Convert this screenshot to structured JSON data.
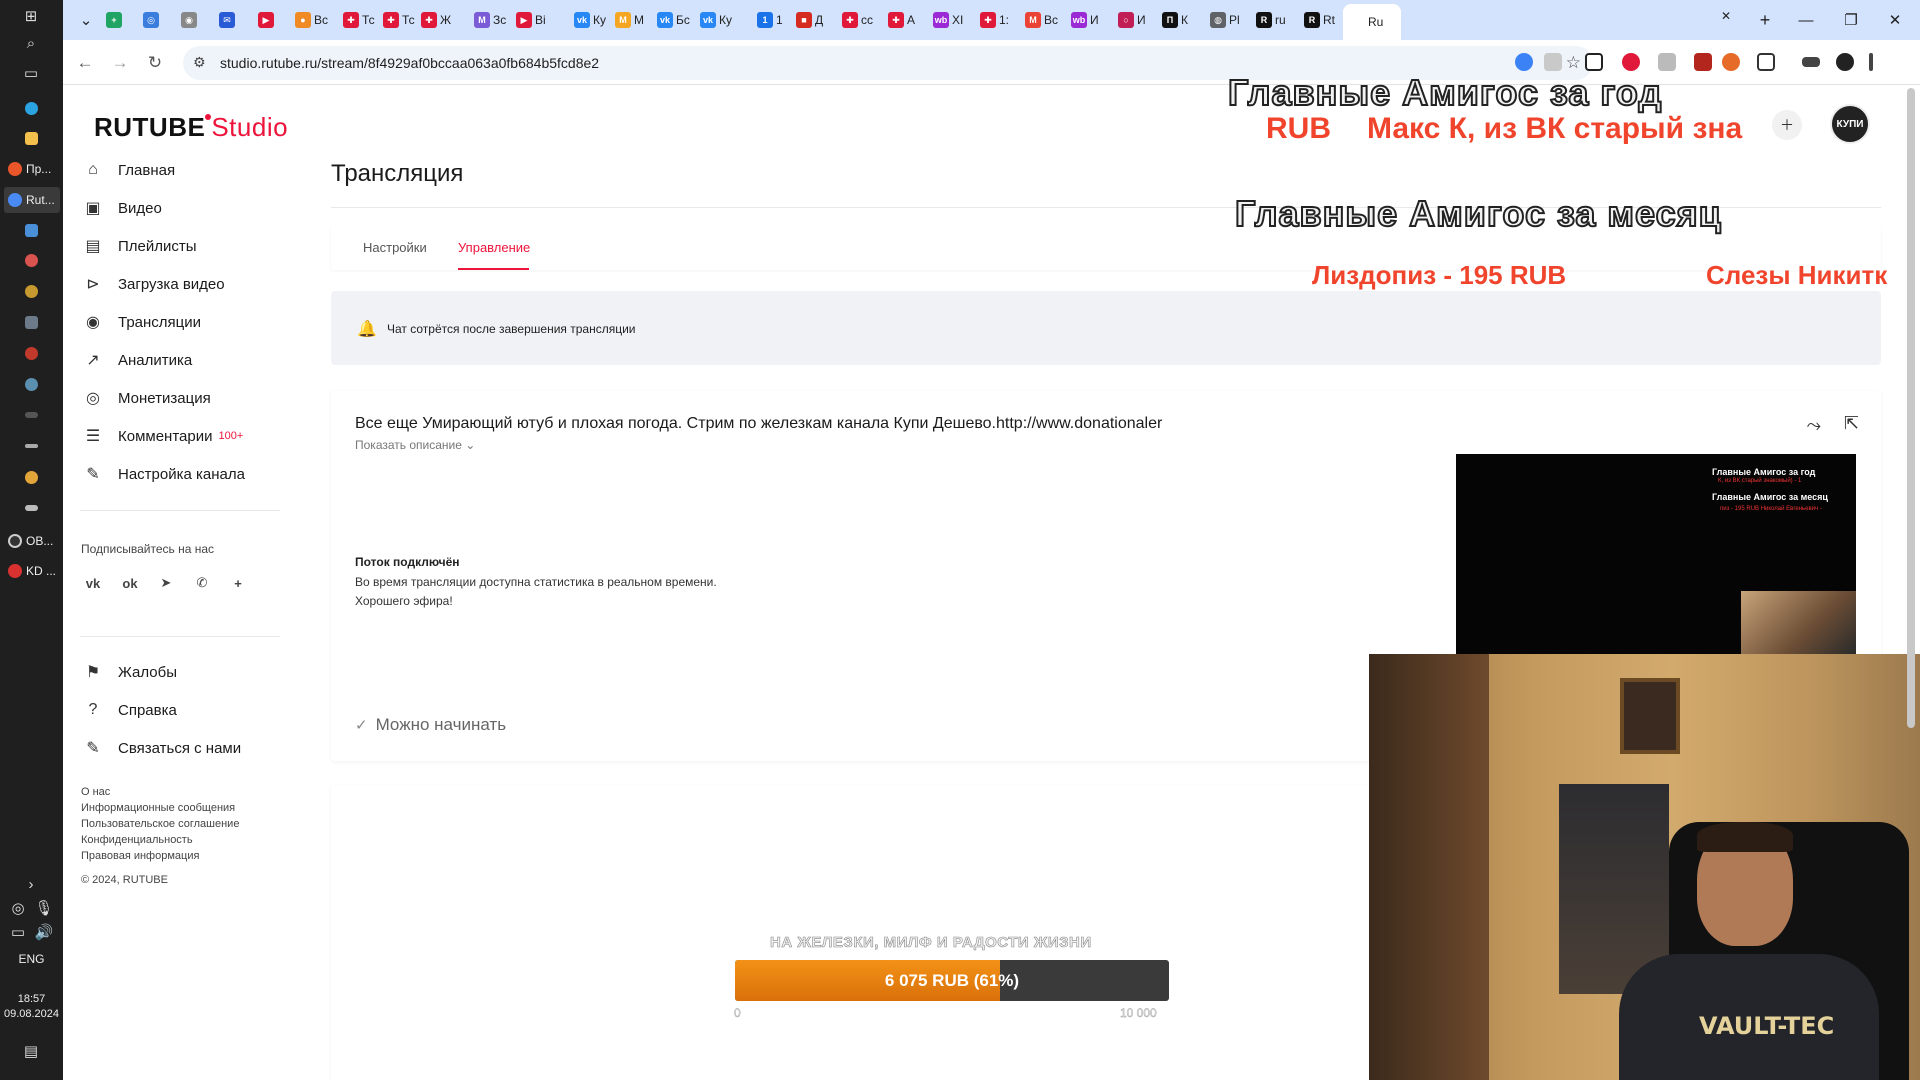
{
  "taskbar": {
    "apps": [
      {
        "label": "Пр...",
        "color": "#e8562a"
      },
      {
        "label": "Rut...",
        "color": "#4a8af4"
      },
      {
        "label": "OB...",
        "color": "#333333"
      },
      {
        "label": "KD ...",
        "color": "#d93030"
      }
    ],
    "language": "ENG",
    "time": "18:57",
    "date": "09.08.2024"
  },
  "browser": {
    "tabs": [
      {
        "label": "",
        "color": "#1fa463",
        "glyph": "+"
      },
      {
        "label": "",
        "color": "#3b7ddd",
        "glyph": "◎"
      },
      {
        "label": "",
        "color": "#888888",
        "glyph": "◉"
      },
      {
        "label": "",
        "color": "#2a5bd7",
        "glyph": "✉"
      },
      {
        "label": "",
        "color": "#e0193a",
        "glyph": "▶"
      },
      {
        "label": "Вс",
        "color": "#f08a24",
        "glyph": "●"
      },
      {
        "label": "Тс",
        "color": "#e0193a",
        "glyph": "✚"
      },
      {
        "label": "Тс",
        "color": "#e0193a",
        "glyph": "✚"
      },
      {
        "label": "Ж",
        "color": "#e0193a",
        "glyph": "✚"
      },
      {
        "label": "Зс",
        "color": "#7b5cd6",
        "glyph": "M"
      },
      {
        "label": "Вi",
        "color": "#e0193a",
        "glyph": "▶"
      },
      {
        "label": "Ку",
        "color": "#2787f5",
        "glyph": "vk"
      },
      {
        "label": "М",
        "color": "#f5a623",
        "glyph": "M"
      },
      {
        "label": "Бс",
        "color": "#2787f5",
        "glyph": "vk"
      },
      {
        "label": "Ку",
        "color": "#2787f5",
        "glyph": "vk"
      },
      {
        "label": "1",
        "color": "#1a73e8",
        "glyph": "1"
      },
      {
        "label": "Д",
        "color": "#d52b1e",
        "glyph": "■"
      },
      {
        "label": "сс",
        "color": "#e0193a",
        "glyph": "✚"
      },
      {
        "label": "А",
        "color": "#e0193a",
        "glyph": "✚"
      },
      {
        "label": "XI",
        "color": "#9b2ad6",
        "glyph": "wb"
      },
      {
        "label": "1:",
        "color": "#e0193a",
        "glyph": "✚"
      },
      {
        "label": "Вс",
        "color": "#ea4335",
        "glyph": "M"
      },
      {
        "label": "И",
        "color": "#9b2ad6",
        "glyph": "wb"
      },
      {
        "label": "И",
        "color": "#c21e56",
        "glyph": "○"
      },
      {
        "label": "К",
        "color": "#111111",
        "glyph": "П"
      },
      {
        "label": "Pl",
        "color": "#5f6368",
        "glyph": "◍"
      },
      {
        "label": "ru",
        "color": "#111111",
        "glyph": "R"
      },
      {
        "label": "Rt",
        "color": "#111111",
        "glyph": "R"
      },
      {
        "label": "Ru",
        "color": "#ffffff",
        "glyph": ""
      }
    ],
    "url": "studio.rutube.ru/stream/8f4929af0bccaa063a0fb684b5fcd8e2"
  },
  "studio": {
    "logo_brand": "RUTUBE",
    "logo_accent": "Studio"
  },
  "sidebar": {
    "items": [
      {
        "label": "Главная",
        "icon": "home-icon",
        "glyph": "⌂"
      },
      {
        "label": "Видео",
        "icon": "video-icon",
        "glyph": "▣"
      },
      {
        "label": "Плейлисты",
        "icon": "playlist-icon",
        "glyph": "▤"
      },
      {
        "label": "Загрузка видео",
        "icon": "upload-icon",
        "glyph": "⊳"
      },
      {
        "label": "Трансляции",
        "icon": "broadcast-icon",
        "glyph": "◉"
      },
      {
        "label": "Аналитика",
        "icon": "analytics-icon",
        "glyph": "↗"
      },
      {
        "label": "Монетизация",
        "icon": "monetization-icon",
        "glyph": "◎"
      },
      {
        "label": "Комментарии",
        "icon": "comments-icon",
        "glyph": "☰",
        "badge": "100+"
      },
      {
        "label": "Настройка канала",
        "icon": "wand-icon",
        "glyph": "✎"
      }
    ],
    "follow_label": "Подписывайтесь на нас",
    "social": [
      {
        "icon": "vk-icon",
        "glyph": "vk"
      },
      {
        "icon": "ok-icon",
        "glyph": "ok"
      },
      {
        "icon": "telegram-icon",
        "glyph": "➤"
      },
      {
        "icon": "viber-icon",
        "glyph": "✆"
      },
      {
        "icon": "more-icon",
        "glyph": "+"
      }
    ],
    "support": [
      {
        "label": "Жалобы",
        "icon": "flag-icon",
        "glyph": "⚑"
      },
      {
        "label": "Справка",
        "icon": "help-icon",
        "glyph": "?"
      },
      {
        "label": "Связаться с нами",
        "icon": "contact-icon",
        "glyph": "✎"
      }
    ],
    "footer_links": [
      "О нас",
      "Информационные сообщения",
      "Пользовательское соглашение",
      "Конфиденциальность",
      "Правовая информация"
    ],
    "copyright": "© 2024, RUTUBE"
  },
  "main": {
    "page_title": "Трансляция",
    "tabs": [
      "Настройки",
      "Управление"
    ],
    "active_tab": "Управление",
    "alert": "Чат сотрётся после завершения трансляции",
    "stream": {
      "title": "Все еще Умирающий ютуб и плохая погода. Стрим по железкам канала Купи Дешево.http://www.donationaler",
      "show_description": "Показать описание",
      "connected": "Поток подключён",
      "stats_note": "Во время трансляции доступна статистика в реальном времени.",
      "good_air": "Хорошего эфира!",
      "ready": "Можно начинать",
      "preview": {
        "line1": "Главные Амигос за год",
        "line2": "К, из ВК старый знакомый) - 1",
        "line3": "Главные Амигос за месяц",
        "line4": "пиз - 195 RUB       Николай Евгеньевич -"
      }
    }
  },
  "overlay": {
    "year_title": "Главные Амигос за  год",
    "year_left": "RUB",
    "year_right": "Макс К, из ВК старый зна",
    "month_title": "Главные Амигос за месяц",
    "month_left": "Лиздопиз - 195 RUB",
    "month_right": "Слезы Никитк",
    "goal_caption": "НА ЖЕЛЕЗКИ, МИЛФ И РАДОСТИ ЖИЗНИ",
    "goal_label": "6 075 RUB (61%)",
    "goal_progress": 0.61,
    "goal_min": "0",
    "goal_max": "10 000"
  },
  "header": {
    "avatar_text": "КУПИ"
  },
  "colors": {
    "accent": "#ed143b",
    "goal_fill": "#ec830f",
    "overlay_red": "#f0452c"
  }
}
